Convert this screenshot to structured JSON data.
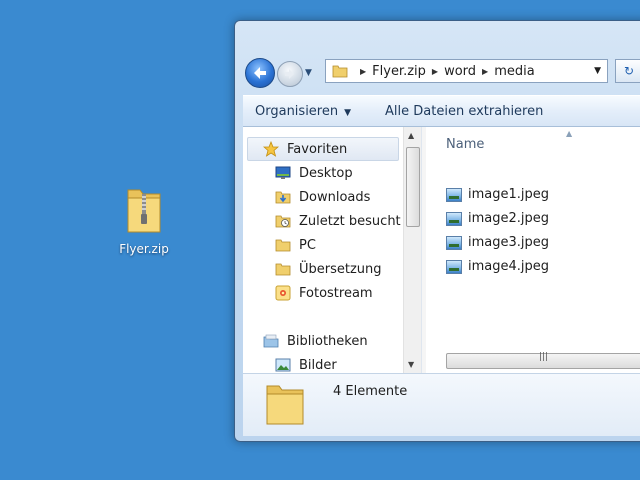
{
  "desktop": {
    "icon_label": "Flyer.zip",
    "icon": "zip-folder-icon"
  },
  "window": {
    "breadcrumb": [
      "Flyer.zip",
      "word",
      "media"
    ],
    "toolbar": {
      "organize": "Organisieren",
      "extract_all": "Alle Dateien extrahieren"
    },
    "nav_pane": {
      "favorites_header": "Favoriten",
      "favorites": [
        "Desktop",
        "Downloads",
        "Zuletzt besucht",
        "PC",
        "Übersetzung",
        "Fotostream"
      ],
      "libraries_header": "Bibliotheken",
      "libraries": [
        "Bilder"
      ]
    },
    "file_list": {
      "column_name": "Name",
      "files": [
        "image1.jpeg",
        "image2.jpeg",
        "image3.jpeg",
        "image4.jpeg"
      ]
    },
    "details": {
      "item_count": "4 Elemente"
    }
  },
  "colors": {
    "desktop_background": "#3a8ad0",
    "window_frame": "#c3d9f0"
  }
}
